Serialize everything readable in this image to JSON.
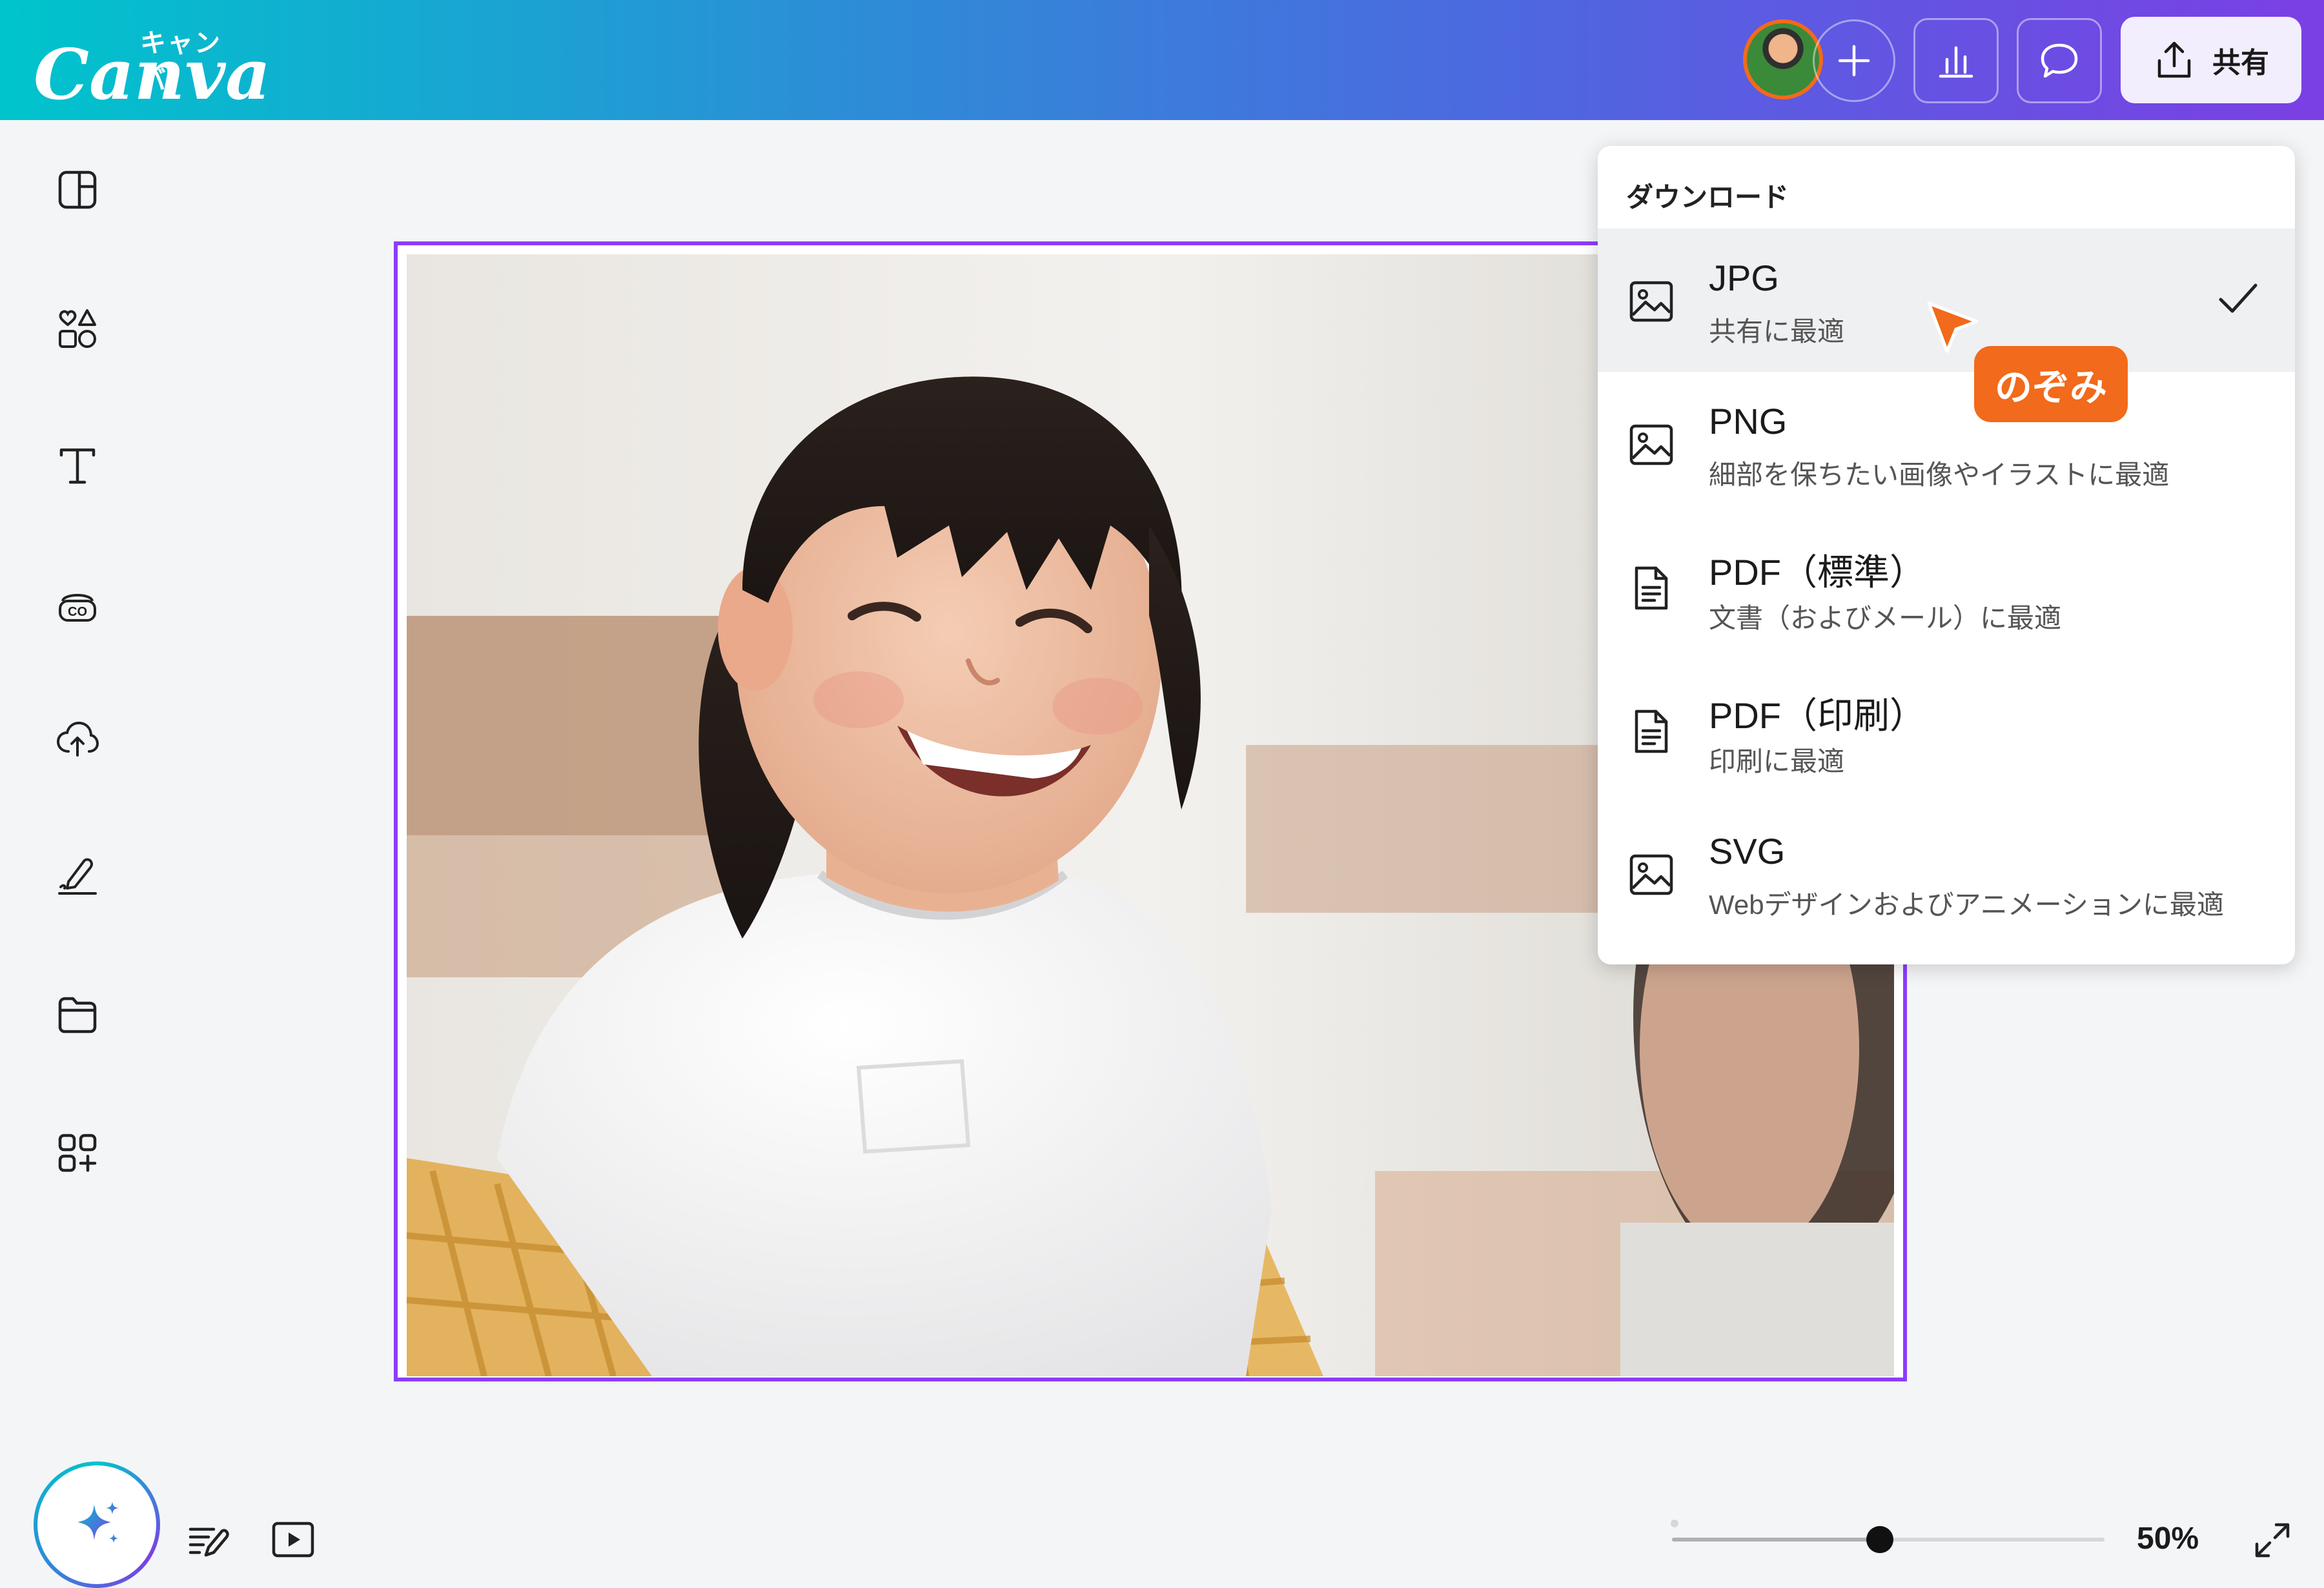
{
  "app": {
    "logo_kana": "キャンバ",
    "logo_word": "Canva"
  },
  "topbar": {
    "share_label": "共有",
    "icons": [
      "add-icon",
      "analytics-icon",
      "comment-icon",
      "upload-icon"
    ]
  },
  "sidebar": {
    "items": [
      {
        "icon": "design-icon"
      },
      {
        "icon": "elements-icon"
      },
      {
        "icon": "text-icon"
      },
      {
        "icon": "brand-icon"
      },
      {
        "icon": "uploads-icon"
      },
      {
        "icon": "draw-icon"
      },
      {
        "icon": "projects-icon"
      },
      {
        "icon": "apps-icon"
      }
    ]
  },
  "download_menu": {
    "title": "ダウンロード",
    "items": [
      {
        "name": "JPG",
        "desc": "共有に最適",
        "icon": "image-icon",
        "selected": true
      },
      {
        "name": "PNG",
        "desc": "細部を保ちたい画像やイラストに最適",
        "icon": "image-icon",
        "selected": false
      },
      {
        "name": "PDF（標準）",
        "desc": "文書（およびメール）に最適",
        "icon": "document-icon",
        "selected": false
      },
      {
        "name": "PDF（印刷）",
        "desc": "印刷に最適",
        "icon": "document-icon",
        "selected": false
      },
      {
        "name": "SVG",
        "desc": "Webデザインおよびアニメーションに最適",
        "icon": "image-icon",
        "selected": false
      }
    ]
  },
  "collaborator": {
    "name": "のぞみ",
    "color": "#f26a1b"
  },
  "bottombar": {
    "zoom_label": "50%",
    "zoom_fraction": 0.48
  },
  "colors": {
    "accent": "#8b3dff",
    "brand_gradient_start": "#00c4cc",
    "brand_gradient_end": "#7b3fe4"
  }
}
